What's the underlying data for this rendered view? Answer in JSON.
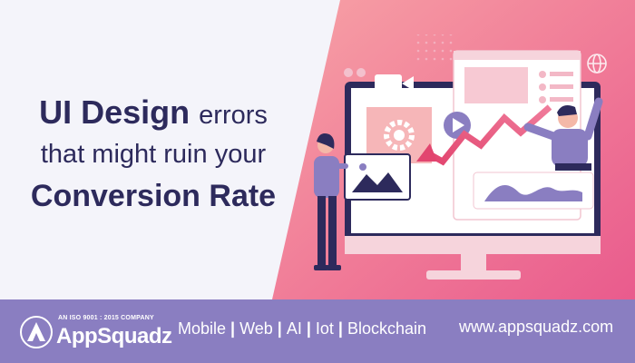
{
  "headline": {
    "bold1": "UI Design",
    "light1": "errors",
    "line2": "that might  ruin your",
    "line3": "Conversion Rate"
  },
  "brand": {
    "tagline": "AN ISO 9001 : 2015 COMPANY",
    "name": "AppSquadz"
  },
  "services": [
    "Mobile",
    "Web",
    "AI",
    "Iot",
    "Blockchain"
  ],
  "website": "www.appsquadz.com",
  "colors": {
    "navy": "#2d2a5c",
    "footer": "#8a7ec1",
    "pink": "#f06a8f",
    "purple": "#7c5cc4"
  }
}
